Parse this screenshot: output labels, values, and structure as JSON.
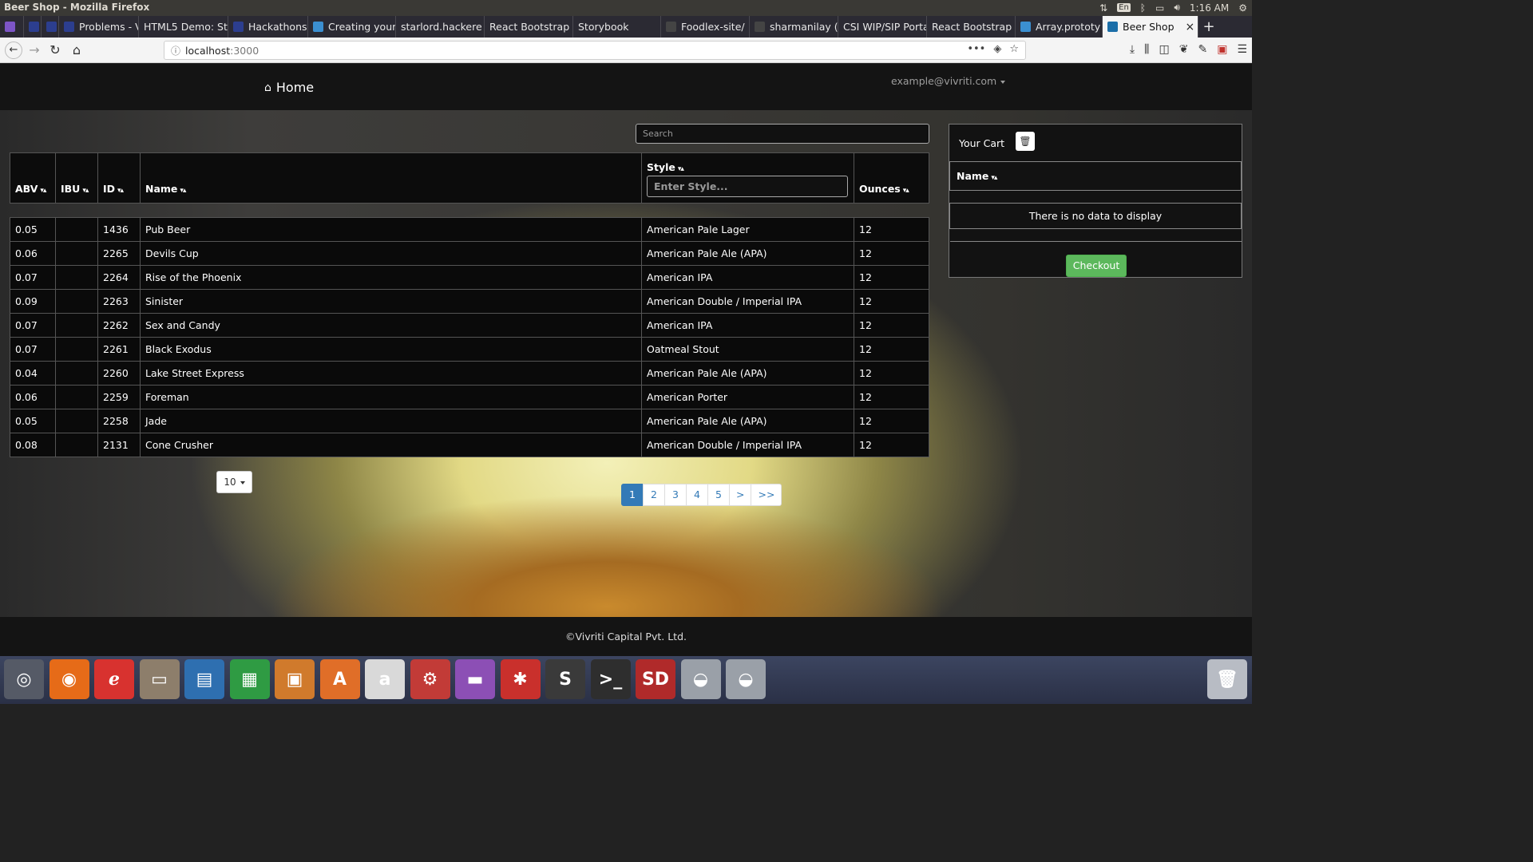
{
  "window": {
    "title": "Beer Shop - Mozilla Firefox",
    "time": "1:16 AM",
    "lang": "En"
  },
  "tabs": [
    {
      "label": "",
      "icon": "app-icon",
      "color": "#7d55c7"
    },
    {
      "label": "",
      "icon": "page-icon",
      "color": "#2c3e8f"
    },
    {
      "label": "",
      "icon": "page-icon",
      "color": "#2c3e8f"
    },
    {
      "label": "Problems - Vi",
      "icon": "page-icon",
      "color": "#2c3e8f"
    },
    {
      "label": "HTML5 Demo: St",
      "icon": "",
      "color": ""
    },
    {
      "label": "Hackathons, I",
      "icon": "page-icon",
      "color": "#2c3e8f"
    },
    {
      "label": "Creating your",
      "icon": "page-icon",
      "color": "#3b8fd1"
    },
    {
      "label": "starlord.hackere",
      "icon": "",
      "color": ""
    },
    {
      "label": "React Bootstrap",
      "icon": "",
      "color": ""
    },
    {
      "label": "Storybook",
      "icon": "",
      "color": ""
    },
    {
      "label": "Foodlex-site/",
      "icon": "github-icon",
      "color": "#444"
    },
    {
      "label": "sharmanilay (",
      "icon": "github-icon",
      "color": "#444"
    },
    {
      "label": "CSI WIP/SIP Porta",
      "icon": "",
      "color": ""
    },
    {
      "label": "React Bootstrap",
      "icon": "",
      "color": ""
    },
    {
      "label": "Array.prototy",
      "icon": "mdn-icon",
      "color": "#3b8fd1"
    },
    {
      "label": "Beer Shop",
      "icon": "react-icon",
      "color": "#1b6ea8"
    }
  ],
  "browser": {
    "url_host": "localhost",
    "url_port": ":3000"
  },
  "app": {
    "home_label": "Home",
    "user_email": "example@vivriti.com",
    "search_placeholder": "Search",
    "style_placeholder": "Enter Style...",
    "footer": "©Vivriti Capital Pvt. Ltd."
  },
  "table": {
    "headers": {
      "abv": "ABV",
      "ibu": "IBU",
      "id": "ID",
      "name": "Name",
      "style": "Style",
      "ounces": "Ounces"
    },
    "rows": [
      {
        "abv": "0.05",
        "ibu": "",
        "id": "1436",
        "name": "Pub Beer",
        "style": "American Pale Lager",
        "ounces": "12"
      },
      {
        "abv": "0.06",
        "ibu": "",
        "id": "2265",
        "name": "Devils Cup",
        "style": "American Pale Ale (APA)",
        "ounces": "12"
      },
      {
        "abv": "0.07",
        "ibu": "",
        "id": "2264",
        "name": "Rise of the Phoenix",
        "style": "American IPA",
        "ounces": "12"
      },
      {
        "abv": "0.09",
        "ibu": "",
        "id": "2263",
        "name": "Sinister",
        "style": "American Double / Imperial IPA",
        "ounces": "12"
      },
      {
        "abv": "0.07",
        "ibu": "",
        "id": "2262",
        "name": "Sex and Candy",
        "style": "American IPA",
        "ounces": "12"
      },
      {
        "abv": "0.07",
        "ibu": "",
        "id": "2261",
        "name": "Black Exodus",
        "style": "Oatmeal Stout",
        "ounces": "12"
      },
      {
        "abv": "0.04",
        "ibu": "",
        "id": "2260",
        "name": "Lake Street Express",
        "style": "American Pale Ale (APA)",
        "ounces": "12"
      },
      {
        "abv": "0.06",
        "ibu": "",
        "id": "2259",
        "name": "Foreman",
        "style": "American Porter",
        "ounces": "12"
      },
      {
        "abv": "0.05",
        "ibu": "",
        "id": "2258",
        "name": "Jade",
        "style": "American Pale Ale (APA)",
        "ounces": "12"
      },
      {
        "abv": "0.08",
        "ibu": "",
        "id": "2131",
        "name": "Cone Crusher",
        "style": "American Double / Imperial IPA",
        "ounces": "12"
      }
    ]
  },
  "pagination": {
    "page_size": "10",
    "pages": [
      "1",
      "2",
      "3",
      "4",
      "5",
      ">",
      ">>"
    ],
    "active": "1"
  },
  "cart": {
    "title": "Your Cart",
    "column": "Name",
    "empty_text": "There is no data to display",
    "checkout_label": "Checkout"
  },
  "dock": [
    {
      "icon": "ubuntu-icon",
      "glyph": "◎",
      "color": "#555a66"
    },
    {
      "icon": "firefox-icon",
      "glyph": "◉",
      "color": "#e66b18"
    },
    {
      "icon": "text-editor-icon",
      "glyph": "ℯ",
      "color": "#d8322f"
    },
    {
      "icon": "files-icon",
      "glyph": "▭",
      "color": "#8d7e6b"
    },
    {
      "icon": "writer-icon",
      "glyph": "▤",
      "color": "#2e6fb0"
    },
    {
      "icon": "calc-icon",
      "glyph": "▦",
      "color": "#2f9b43"
    },
    {
      "icon": "impress-icon",
      "glyph": "▣",
      "color": "#d07a2c"
    },
    {
      "icon": "software-center-icon",
      "glyph": "A",
      "color": "#e06e28"
    },
    {
      "icon": "amazon-icon",
      "glyph": "a",
      "color": "#d9d9d9"
    },
    {
      "icon": "settings-icon",
      "glyph": "⚙",
      "color": "#c23b37"
    },
    {
      "icon": "workspace-icon",
      "glyph": "▬",
      "color": "#8c4fb5"
    },
    {
      "icon": "web-icon",
      "glyph": "✱",
      "color": "#c9302c"
    },
    {
      "icon": "sublime-icon",
      "glyph": "S",
      "color": "#3a3a3a"
    },
    {
      "icon": "terminal-icon",
      "glyph": ">_",
      "color": "#2e2e2e"
    },
    {
      "icon": "sd-card-icon",
      "glyph": "SD",
      "color": "#b02a2a"
    },
    {
      "icon": "drive-icon",
      "glyph": "◒",
      "color": "#9aa0a8"
    },
    {
      "icon": "drive-icon",
      "glyph": "◒",
      "color": "#9aa0a8"
    },
    {
      "icon": "trash-icon",
      "glyph": "🗑",
      "color": "#b8bcc4"
    }
  ]
}
